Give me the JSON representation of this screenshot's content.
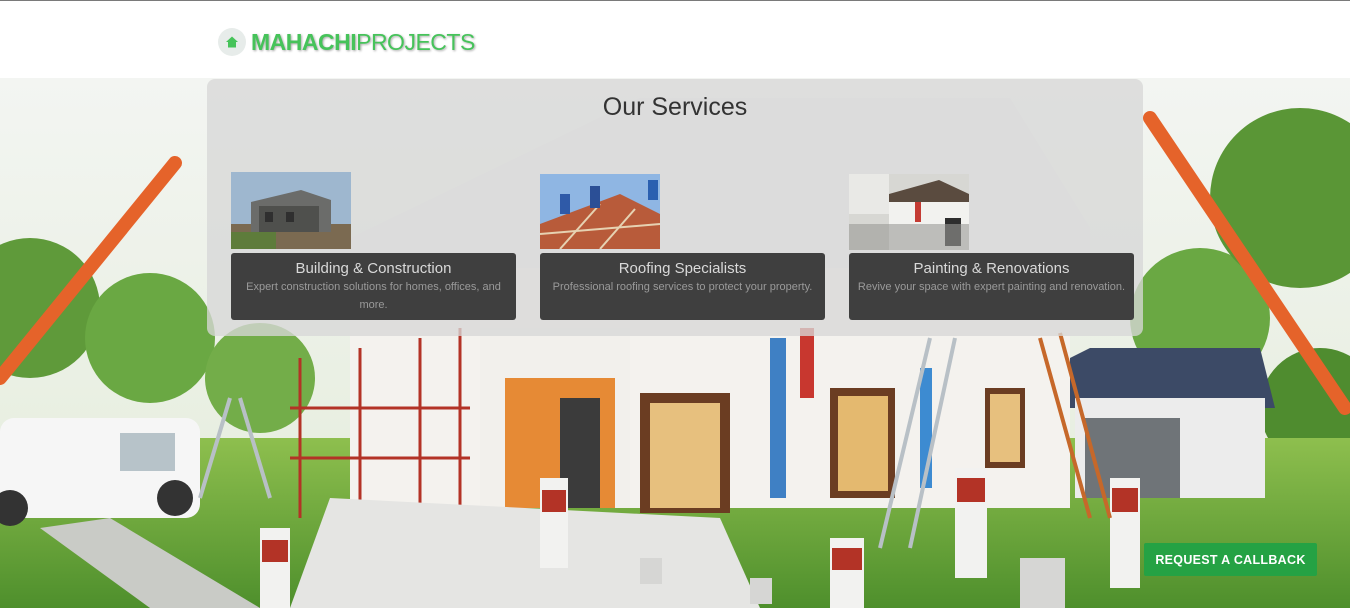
{
  "header": {
    "logo_strong": "MAHACHI",
    "logo_light": "PROJECTS",
    "logo_icon": "house-icon"
  },
  "services": {
    "title": "Our Services",
    "cards": [
      {
        "title": "Building & Construction",
        "description": "Expert construction solutions for homes, offices, and more.",
        "image": "construction-site-photo"
      },
      {
        "title": "Roofing Specialists",
        "description": "Professional roofing services to protect your property.",
        "image": "roofers-photo"
      },
      {
        "title": "Painting & Renovations",
        "description": "Revive your space with expert painting and renovation.",
        "image": "painters-photo"
      }
    ]
  },
  "cta": {
    "label": "REQUEST A CALLBACK"
  },
  "colors": {
    "brand_green": "#46c35a",
    "cta_green": "#25a244",
    "card_dark": "#3f3f3f"
  }
}
